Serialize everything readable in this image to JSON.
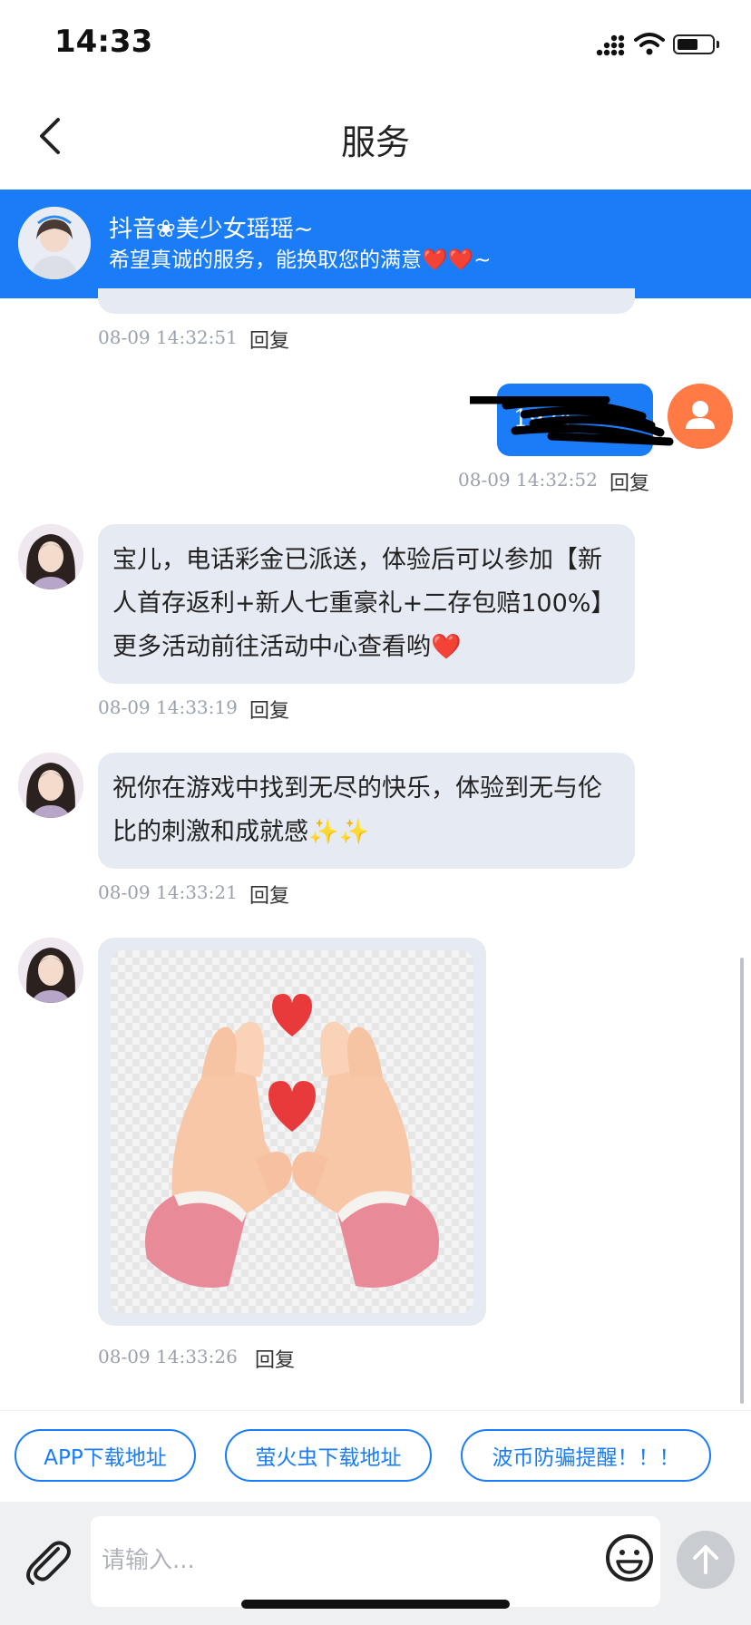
{
  "status_bar": {
    "time": "14:33"
  },
  "nav": {
    "title": "服务"
  },
  "agent": {
    "name": "抖音❀美少女瑶瑶~",
    "motto": "希望真诚的服务，能换取您的满意❤️❤️~"
  },
  "messages": [
    {
      "side": "left",
      "timestamp": "08-09 14:32:51",
      "reply": "回复"
    },
    {
      "side": "right",
      "text": "1924",
      "timestamp": "08-09 14:32:52",
      "reply": "回复"
    },
    {
      "side": "left",
      "text": "宝儿，电话彩金已派送，体验后可以参加【新人首存返利+新人七重豪礼+二存包赔100%】更多活动前往活动中心查看哟❤️",
      "timestamp": "08-09 14:33:19",
      "reply": "回复"
    },
    {
      "side": "left",
      "text": "祝你在游戏中找到无尽的快乐，体验到无与伦比的刺激和成就感✨✨",
      "timestamp": "08-09 14:33:21",
      "reply": "回复"
    },
    {
      "side": "left",
      "image": "heart-hands-sticker",
      "timestamp": "08-09 14:33:26",
      "reply": "回复"
    }
  ],
  "quick_buttons": [
    "APP下载地址",
    "萤火虫下载地址",
    "波币防骗提醒！！！"
  ],
  "input": {
    "placeholder": "请输入..."
  },
  "colors": {
    "accent": "#1a7cf7",
    "bubble_left": "#e5eaf3",
    "user_avatar": "#ff7a45",
    "input_bar": "#eff0f2"
  },
  "icons": [
    "back-chevron-icon",
    "signal-icon",
    "wifi-icon",
    "battery-icon",
    "user-avatar-icon",
    "paperclip-icon",
    "emoji-icon",
    "send-arrow-icon"
  ]
}
